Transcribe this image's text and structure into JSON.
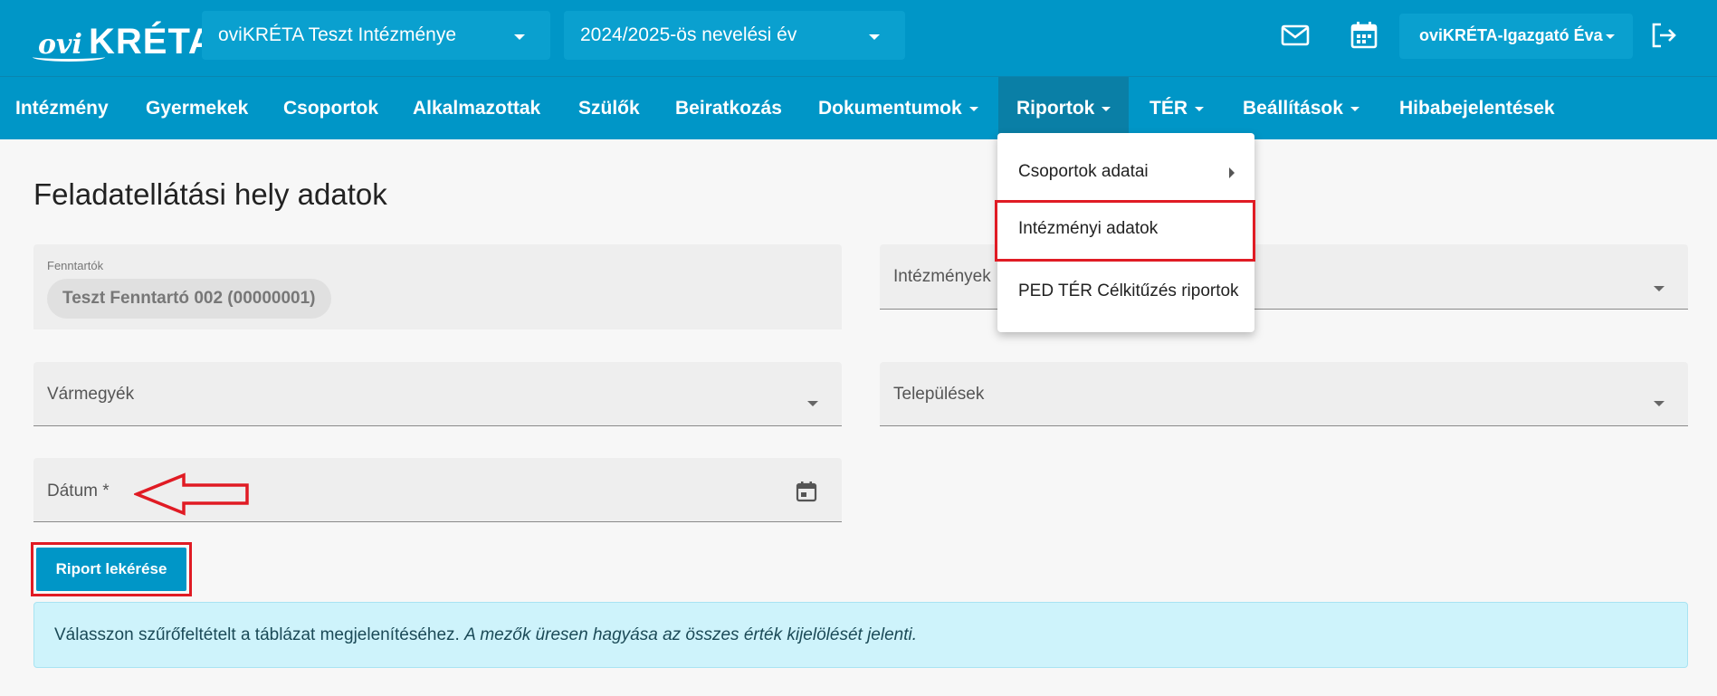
{
  "header": {
    "logo_ovi": "ovi",
    "logo_kreta": "KRÉTA",
    "institution_select": "oviKRÉTA Teszt Intézménye",
    "year_select": "2024/2025-ös nevelési év",
    "user_name": "oviKRÉTA-Igazgató Éva"
  },
  "nav": {
    "items": [
      {
        "label": "Intézmény"
      },
      {
        "label": "Gyermekek"
      },
      {
        "label": "Csoportok"
      },
      {
        "label": "Alkalmazottak"
      },
      {
        "label": "Szülők"
      },
      {
        "label": "Beiratkozás"
      },
      {
        "label": "Dokumentumok"
      },
      {
        "label": "Riportok"
      },
      {
        "label": "TÉR"
      },
      {
        "label": "Beállítások"
      },
      {
        "label": "Hibabejelentések"
      }
    ],
    "active": "Riportok"
  },
  "dropdown": {
    "items": [
      {
        "label": "Csoportok adatai"
      },
      {
        "label": "Intézményi adatok"
      },
      {
        "label": "PED TÉR Célkitűzés riportok"
      }
    ],
    "highlighted": "Intézményi adatok"
  },
  "page": {
    "title": "Feladatellátási hely adatok",
    "fenntartok_label": "Fenntartók",
    "fenntartok_chip": "Teszt Fenntartó 002 (00000001)",
    "intezmenyek_label": "Intézmények",
    "varmegyek_label": "Vármegyék",
    "telepulesek_label": "Települések",
    "datum_label": "Dátum *",
    "submit_label": "Riport lekérése",
    "alert_text": "Válasszon szűrőfeltételt a táblázat megjelenítéséhez.",
    "alert_italic": "A mezők üresen hagyása az összes érték kijelölését jelenti."
  },
  "colors": {
    "primary": "#0096c7",
    "active_nav": "#0a7fa6",
    "annotation": "#e01b24",
    "alert_bg": "#cef3fb"
  }
}
